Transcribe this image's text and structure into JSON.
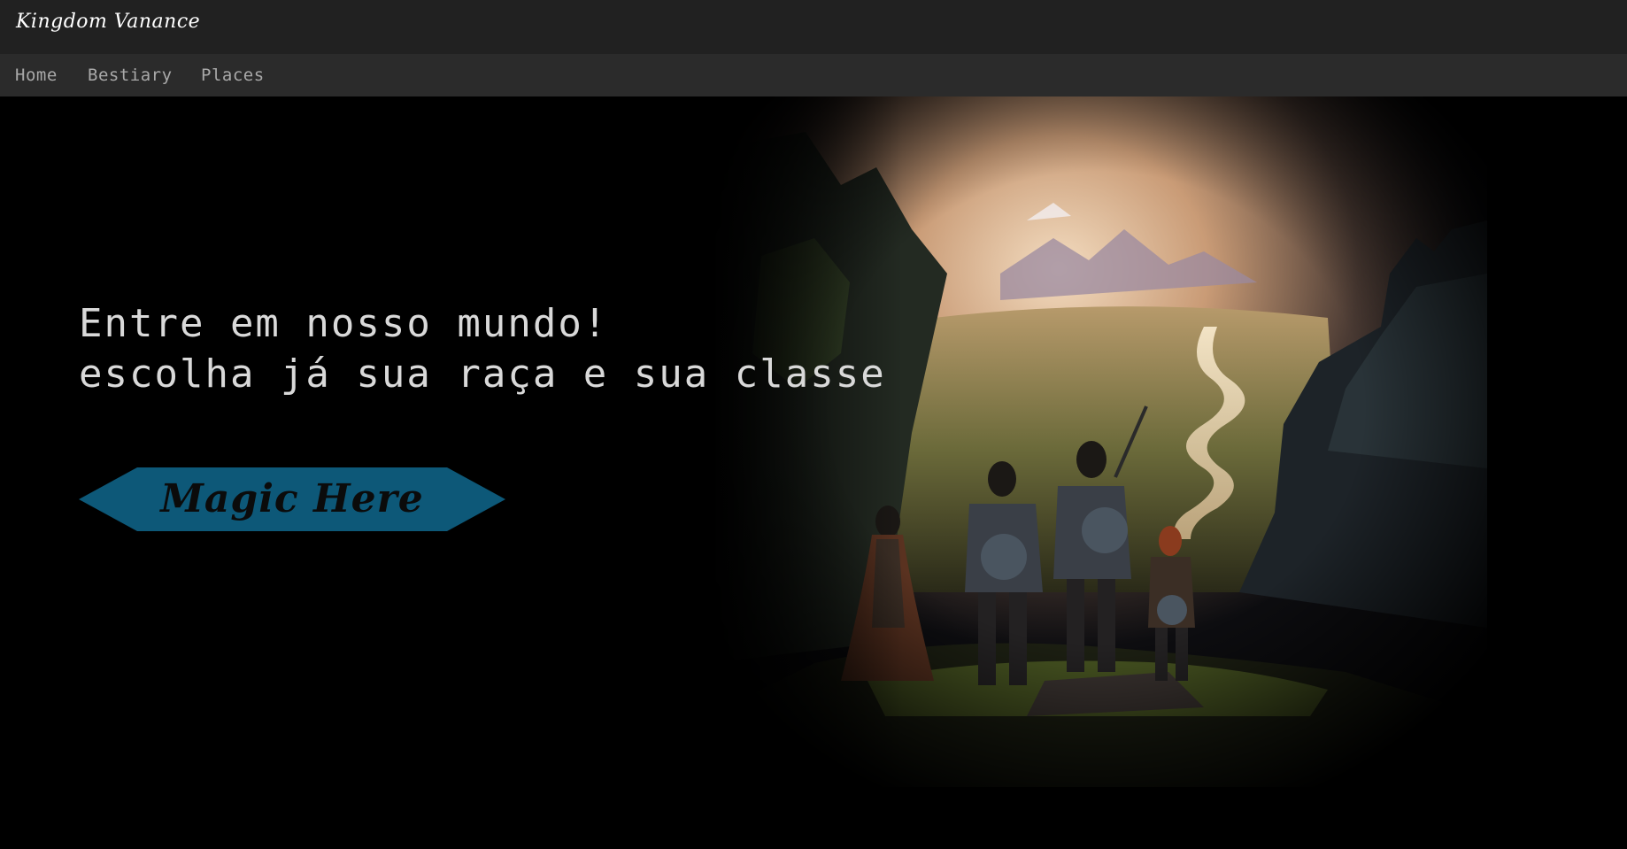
{
  "header": {
    "brand": "Kingdom Vanance"
  },
  "nav": {
    "items": [
      {
        "label": "Home"
      },
      {
        "label": "Bestiary"
      },
      {
        "label": "Places"
      }
    ]
  },
  "hero": {
    "headline_line1": "Entre em nosso mundo!",
    "headline_line2": "escolha já sua raça e sua classe",
    "cta_label": "Magic Here",
    "image_icon": "fantasy-landscape-image"
  },
  "colors": {
    "topbar": "#212121",
    "navbar": "#2b2b2b",
    "background": "#000000",
    "cta": "#0d5878",
    "nav_text": "#a9a9a9",
    "headline_text": "#d9d9d9"
  }
}
